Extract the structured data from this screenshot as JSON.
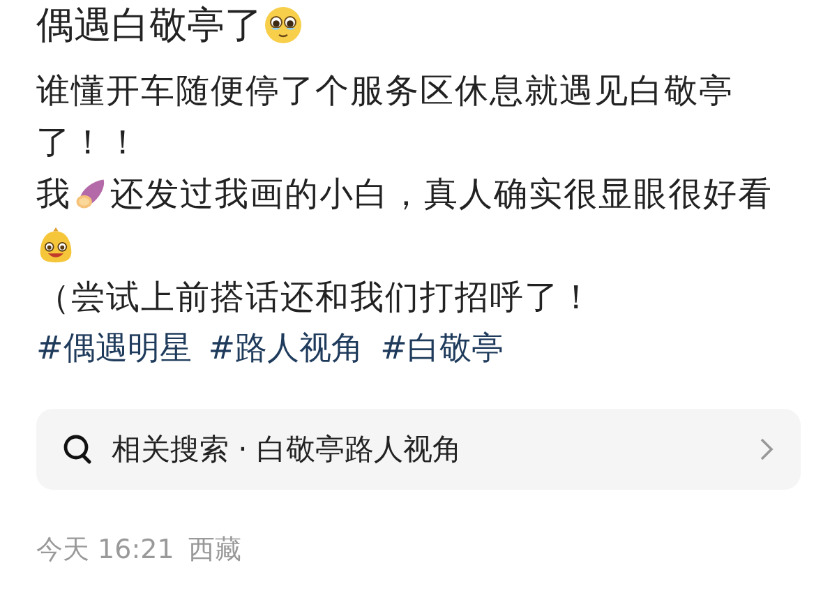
{
  "post": {
    "title": [
      {
        "kind": "text",
        "text": "偶遇白敬亭了"
      },
      {
        "kind": "tearful-face"
      }
    ],
    "lines": [
      [
        {
          "kind": "text",
          "text": "谁懂开车随便停了个服务区休息就遇见白敬亭"
        }
      ],
      [
        {
          "kind": "text",
          "text": "了！！"
        }
      ],
      [
        {
          "kind": "text",
          "text": "我"
        },
        {
          "kind": "sweet-potato"
        },
        {
          "kind": "text",
          "text": "还发过我画的小白，真人确实很显眼很好看"
        }
      ],
      [
        {
          "kind": "bag-face"
        }
      ],
      [
        {
          "kind": "text",
          "text": "（尝试上前搭话还和我们打招呼了！"
        }
      ]
    ],
    "hashtags": [
      "#偶遇明星",
      "#路人视角",
      "#白敬亭"
    ]
  },
  "related_search": {
    "label": "相关搜索 · 白敬亭路人视角"
  },
  "footer": {
    "time": "今天 16:21",
    "location": "西藏"
  }
}
